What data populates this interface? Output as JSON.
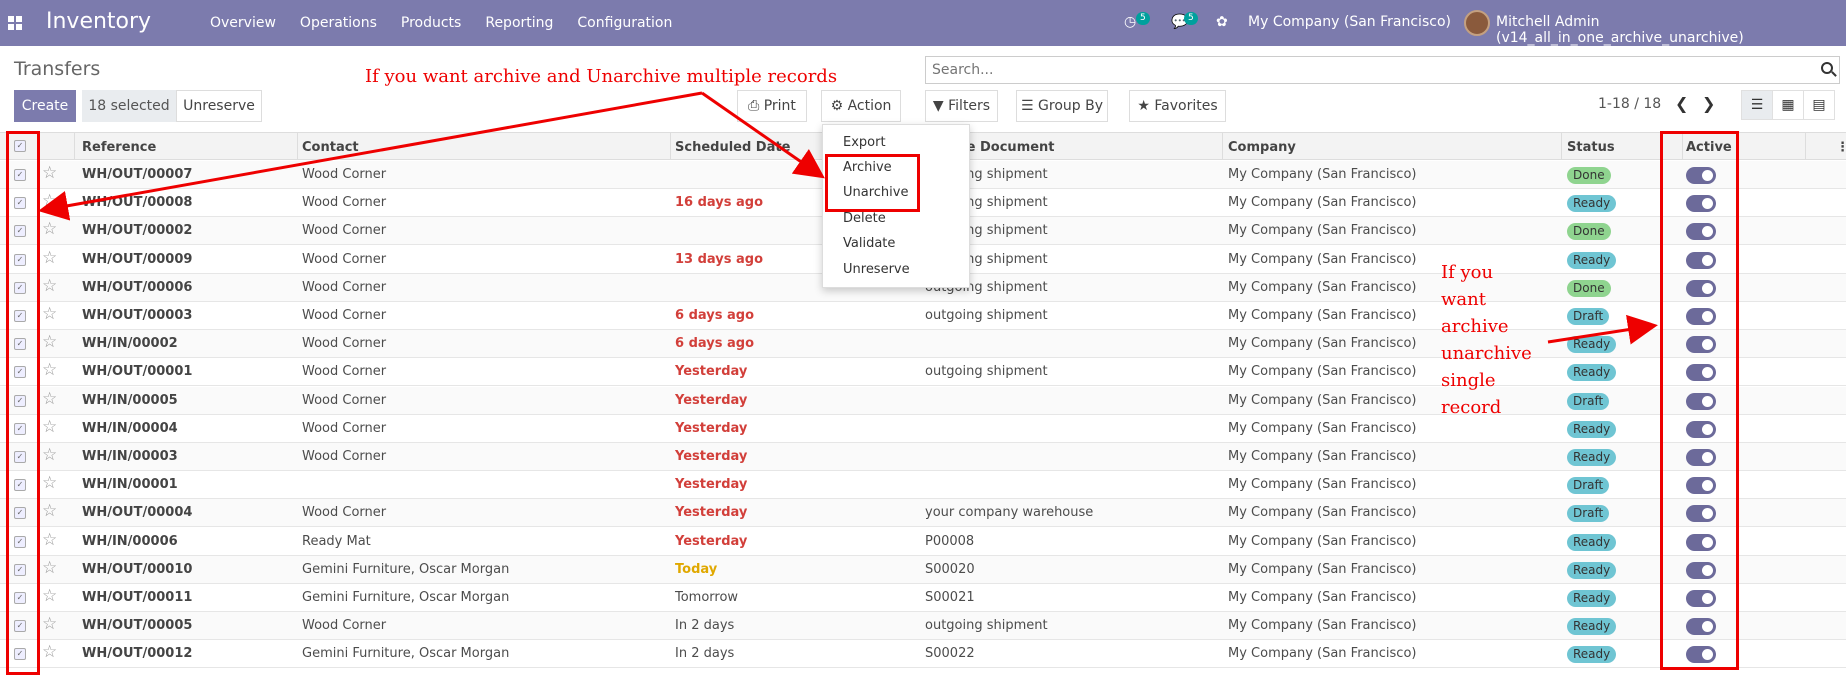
{
  "app": {
    "name": "Inventory",
    "menu": [
      "Overview",
      "Operations",
      "Products",
      "Reporting",
      "Configuration"
    ],
    "activity_count": "5",
    "message_count": "5",
    "company": "My Company (San Francisco)",
    "user": "Mitchell Admin (v14_all_in_one_archive_unarchive)"
  },
  "page": {
    "title": "Transfers",
    "create_label": "Create",
    "selected_label": "18 selected",
    "unreserve_label": "Unreserve",
    "print_label": "Print",
    "action_label": "Action",
    "search_placeholder": "Search...",
    "filters_label": "Filters",
    "groupby_label": "Group By",
    "favorites_label": "Favorites",
    "pager": "1-18 / 18"
  },
  "columns": [
    "Reference",
    "Contact",
    "Scheduled Date",
    "Source Document",
    "Company",
    "Status",
    "Active"
  ],
  "rows": [
    {
      "ref": "WH/OUT/00007",
      "contact": "Wood Corner",
      "date": "",
      "date_color": "",
      "source": "outgoing shipment",
      "company": "My Company (San Francisco)",
      "status": "Done"
    },
    {
      "ref": "WH/OUT/00008",
      "contact": "Wood Corner",
      "date": "16 days ago",
      "date_color": "#d23f3a",
      "source": "outgoing shipment",
      "company": "My Company (San Francisco)",
      "status": "Ready"
    },
    {
      "ref": "WH/OUT/00002",
      "contact": "Wood Corner",
      "date": "",
      "date_color": "",
      "source": "outgoing shipment",
      "company": "My Company (San Francisco)",
      "status": "Done"
    },
    {
      "ref": "WH/OUT/00009",
      "contact": "Wood Corner",
      "date": "13 days ago",
      "date_color": "#d23f3a",
      "source": "outgoing shipment",
      "company": "My Company (San Francisco)",
      "status": "Ready"
    },
    {
      "ref": "WH/OUT/00006",
      "contact": "Wood Corner",
      "date": "",
      "date_color": "",
      "source": "outgoing shipment",
      "company": "My Company (San Francisco)",
      "status": "Done"
    },
    {
      "ref": "WH/OUT/00003",
      "contact": "Wood Corner",
      "date": "6 days ago",
      "date_color": "#d23f3a",
      "source": "outgoing shipment",
      "company": "My Company (San Francisco)",
      "status": "Draft"
    },
    {
      "ref": "WH/IN/00002",
      "contact": "Wood Corner",
      "date": "6 days ago",
      "date_color": "#d23f3a",
      "source": "",
      "company": "My Company (San Francisco)",
      "status": "Ready"
    },
    {
      "ref": "WH/OUT/00001",
      "contact": "Wood Corner",
      "date": "Yesterday",
      "date_color": "#d23f3a",
      "source": "outgoing shipment",
      "company": "My Company (San Francisco)",
      "status": "Ready"
    },
    {
      "ref": "WH/IN/00005",
      "contact": "Wood Corner",
      "date": "Yesterday",
      "date_color": "#d23f3a",
      "source": "",
      "company": "My Company (San Francisco)",
      "status": "Draft"
    },
    {
      "ref": "WH/IN/00004",
      "contact": "Wood Corner",
      "date": "Yesterday",
      "date_color": "#d23f3a",
      "source": "",
      "company": "My Company (San Francisco)",
      "status": "Ready"
    },
    {
      "ref": "WH/IN/00003",
      "contact": "Wood Corner",
      "date": "Yesterday",
      "date_color": "#d23f3a",
      "source": "",
      "company": "My Company (San Francisco)",
      "status": "Ready"
    },
    {
      "ref": "WH/IN/00001",
      "contact": "",
      "date": "Yesterday",
      "date_color": "#d23f3a",
      "source": "",
      "company": "My Company (San Francisco)",
      "status": "Draft"
    },
    {
      "ref": "WH/OUT/00004",
      "contact": "Wood Corner",
      "date": "Yesterday",
      "date_color": "#d23f3a",
      "source": "your company warehouse",
      "company": "My Company (San Francisco)",
      "status": "Draft"
    },
    {
      "ref": "WH/IN/00006",
      "contact": "Ready Mat",
      "date": "Yesterday",
      "date_color": "#d23f3a",
      "source": "P00008",
      "company": "My Company (San Francisco)",
      "status": "Ready"
    },
    {
      "ref": "WH/OUT/00010",
      "contact": "Gemini Furniture, Oscar Morgan",
      "date": "Today",
      "date_color": "#e0a800",
      "source": "S00020",
      "company": "My Company (San Francisco)",
      "status": "Ready"
    },
    {
      "ref": "WH/OUT/00011",
      "contact": "Gemini Furniture, Oscar Morgan",
      "date": "Tomorrow",
      "date_color": "",
      "source": "S00021",
      "company": "My Company (San Francisco)",
      "status": "Ready"
    },
    {
      "ref": "WH/OUT/00005",
      "contact": "Wood Corner",
      "date": "In 2 days",
      "date_color": "",
      "source": "outgoing shipment",
      "company": "My Company (San Francisco)",
      "status": "Ready"
    },
    {
      "ref": "WH/OUT/00012",
      "contact": "Gemini Furniture, Oscar Morgan",
      "date": "In 2 days",
      "date_color": "",
      "source": "S00022",
      "company": "My Company (San Francisco)",
      "status": "Ready"
    }
  ],
  "status_colors": {
    "Done": "#8fd48f",
    "Ready": "#6fc5d3",
    "Draft": "#6fc5d3"
  },
  "action_menu": [
    "Export",
    "Archive",
    "Unarchive",
    "Delete",
    "Validate",
    "Unreserve"
  ],
  "annotations": {
    "multi": "If you want archive and Unarchive multiple records",
    "single_lines": [
      "If you",
      "want",
      "archive",
      "unarchive",
      "single",
      "record"
    ]
  }
}
